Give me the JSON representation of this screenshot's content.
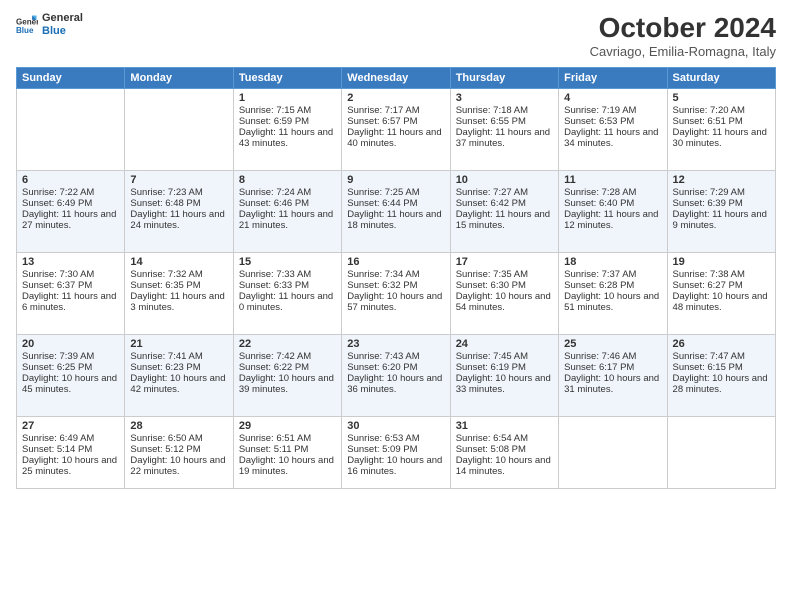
{
  "logo": {
    "line1": "General",
    "line2": "Blue"
  },
  "title": "October 2024",
  "location": "Cavriago, Emilia-Romagna, Italy",
  "days_of_week": [
    "Sunday",
    "Monday",
    "Tuesday",
    "Wednesday",
    "Thursday",
    "Friday",
    "Saturday"
  ],
  "weeks": [
    [
      {
        "day": "",
        "sunrise": "",
        "sunset": "",
        "daylight": ""
      },
      {
        "day": "",
        "sunrise": "",
        "sunset": "",
        "daylight": ""
      },
      {
        "day": "1",
        "sunrise": "Sunrise: 7:15 AM",
        "sunset": "Sunset: 6:59 PM",
        "daylight": "Daylight: 11 hours and 43 minutes."
      },
      {
        "day": "2",
        "sunrise": "Sunrise: 7:17 AM",
        "sunset": "Sunset: 6:57 PM",
        "daylight": "Daylight: 11 hours and 40 minutes."
      },
      {
        "day": "3",
        "sunrise": "Sunrise: 7:18 AM",
        "sunset": "Sunset: 6:55 PM",
        "daylight": "Daylight: 11 hours and 37 minutes."
      },
      {
        "day": "4",
        "sunrise": "Sunrise: 7:19 AM",
        "sunset": "Sunset: 6:53 PM",
        "daylight": "Daylight: 11 hours and 34 minutes."
      },
      {
        "day": "5",
        "sunrise": "Sunrise: 7:20 AM",
        "sunset": "Sunset: 6:51 PM",
        "daylight": "Daylight: 11 hours and 30 minutes."
      }
    ],
    [
      {
        "day": "6",
        "sunrise": "Sunrise: 7:22 AM",
        "sunset": "Sunset: 6:49 PM",
        "daylight": "Daylight: 11 hours and 27 minutes."
      },
      {
        "day": "7",
        "sunrise": "Sunrise: 7:23 AM",
        "sunset": "Sunset: 6:48 PM",
        "daylight": "Daylight: 11 hours and 24 minutes."
      },
      {
        "day": "8",
        "sunrise": "Sunrise: 7:24 AM",
        "sunset": "Sunset: 6:46 PM",
        "daylight": "Daylight: 11 hours and 21 minutes."
      },
      {
        "day": "9",
        "sunrise": "Sunrise: 7:25 AM",
        "sunset": "Sunset: 6:44 PM",
        "daylight": "Daylight: 11 hours and 18 minutes."
      },
      {
        "day": "10",
        "sunrise": "Sunrise: 7:27 AM",
        "sunset": "Sunset: 6:42 PM",
        "daylight": "Daylight: 11 hours and 15 minutes."
      },
      {
        "day": "11",
        "sunrise": "Sunrise: 7:28 AM",
        "sunset": "Sunset: 6:40 PM",
        "daylight": "Daylight: 11 hours and 12 minutes."
      },
      {
        "day": "12",
        "sunrise": "Sunrise: 7:29 AM",
        "sunset": "Sunset: 6:39 PM",
        "daylight": "Daylight: 11 hours and 9 minutes."
      }
    ],
    [
      {
        "day": "13",
        "sunrise": "Sunrise: 7:30 AM",
        "sunset": "Sunset: 6:37 PM",
        "daylight": "Daylight: 11 hours and 6 minutes."
      },
      {
        "day": "14",
        "sunrise": "Sunrise: 7:32 AM",
        "sunset": "Sunset: 6:35 PM",
        "daylight": "Daylight: 11 hours and 3 minutes."
      },
      {
        "day": "15",
        "sunrise": "Sunrise: 7:33 AM",
        "sunset": "Sunset: 6:33 PM",
        "daylight": "Daylight: 11 hours and 0 minutes."
      },
      {
        "day": "16",
        "sunrise": "Sunrise: 7:34 AM",
        "sunset": "Sunset: 6:32 PM",
        "daylight": "Daylight: 10 hours and 57 minutes."
      },
      {
        "day": "17",
        "sunrise": "Sunrise: 7:35 AM",
        "sunset": "Sunset: 6:30 PM",
        "daylight": "Daylight: 10 hours and 54 minutes."
      },
      {
        "day": "18",
        "sunrise": "Sunrise: 7:37 AM",
        "sunset": "Sunset: 6:28 PM",
        "daylight": "Daylight: 10 hours and 51 minutes."
      },
      {
        "day": "19",
        "sunrise": "Sunrise: 7:38 AM",
        "sunset": "Sunset: 6:27 PM",
        "daylight": "Daylight: 10 hours and 48 minutes."
      }
    ],
    [
      {
        "day": "20",
        "sunrise": "Sunrise: 7:39 AM",
        "sunset": "Sunset: 6:25 PM",
        "daylight": "Daylight: 10 hours and 45 minutes."
      },
      {
        "day": "21",
        "sunrise": "Sunrise: 7:41 AM",
        "sunset": "Sunset: 6:23 PM",
        "daylight": "Daylight: 10 hours and 42 minutes."
      },
      {
        "day": "22",
        "sunrise": "Sunrise: 7:42 AM",
        "sunset": "Sunset: 6:22 PM",
        "daylight": "Daylight: 10 hours and 39 minutes."
      },
      {
        "day": "23",
        "sunrise": "Sunrise: 7:43 AM",
        "sunset": "Sunset: 6:20 PM",
        "daylight": "Daylight: 10 hours and 36 minutes."
      },
      {
        "day": "24",
        "sunrise": "Sunrise: 7:45 AM",
        "sunset": "Sunset: 6:19 PM",
        "daylight": "Daylight: 10 hours and 33 minutes."
      },
      {
        "day": "25",
        "sunrise": "Sunrise: 7:46 AM",
        "sunset": "Sunset: 6:17 PM",
        "daylight": "Daylight: 10 hours and 31 minutes."
      },
      {
        "day": "26",
        "sunrise": "Sunrise: 7:47 AM",
        "sunset": "Sunset: 6:15 PM",
        "daylight": "Daylight: 10 hours and 28 minutes."
      }
    ],
    [
      {
        "day": "27",
        "sunrise": "Sunrise: 6:49 AM",
        "sunset": "Sunset: 5:14 PM",
        "daylight": "Daylight: 10 hours and 25 minutes."
      },
      {
        "day": "28",
        "sunrise": "Sunrise: 6:50 AM",
        "sunset": "Sunset: 5:12 PM",
        "daylight": "Daylight: 10 hours and 22 minutes."
      },
      {
        "day": "29",
        "sunrise": "Sunrise: 6:51 AM",
        "sunset": "Sunset: 5:11 PM",
        "daylight": "Daylight: 10 hours and 19 minutes."
      },
      {
        "day": "30",
        "sunrise": "Sunrise: 6:53 AM",
        "sunset": "Sunset: 5:09 PM",
        "daylight": "Daylight: 10 hours and 16 minutes."
      },
      {
        "day": "31",
        "sunrise": "Sunrise: 6:54 AM",
        "sunset": "Sunset: 5:08 PM",
        "daylight": "Daylight: 10 hours and 14 minutes."
      },
      {
        "day": "",
        "sunrise": "",
        "sunset": "",
        "daylight": ""
      },
      {
        "day": "",
        "sunrise": "",
        "sunset": "",
        "daylight": ""
      }
    ]
  ]
}
